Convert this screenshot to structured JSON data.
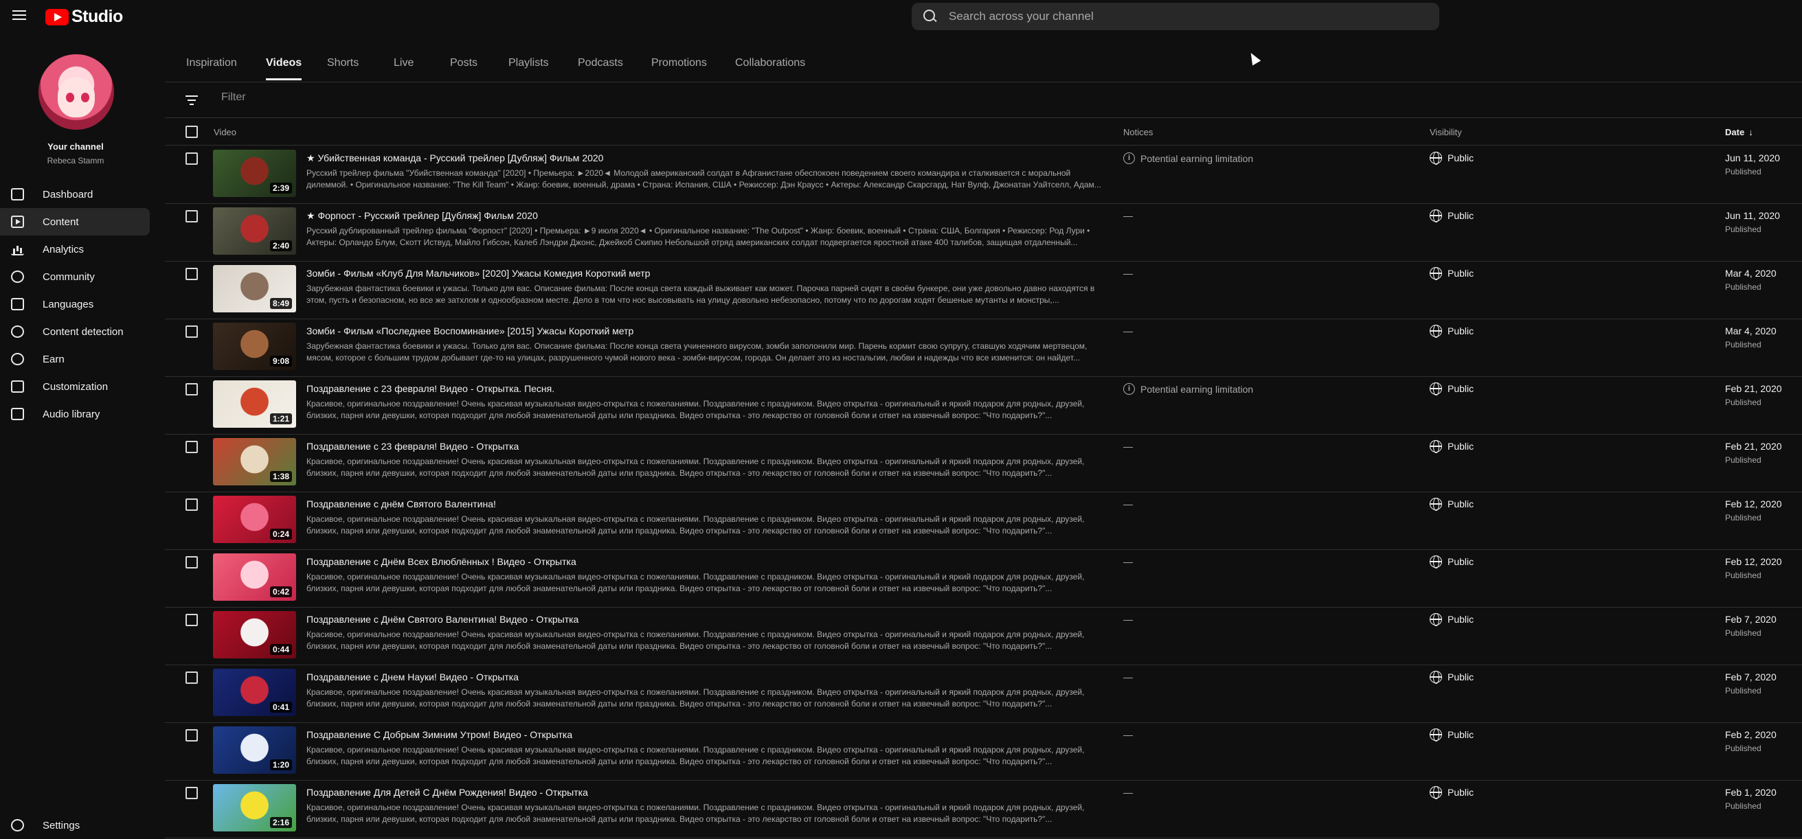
{
  "app": {
    "logo_text": "Studio"
  },
  "search": {
    "placeholder": "Search across your channel"
  },
  "channel": {
    "label": "Your channel",
    "name": "Rebeca Stamm"
  },
  "nav": [
    {
      "label": "Dashboard",
      "icon": "dashboard-icon"
    },
    {
      "label": "Content",
      "icon": "content-icon",
      "active": true
    },
    {
      "label": "Analytics",
      "icon": "analytics-icon"
    },
    {
      "label": "Community",
      "icon": "community-icon"
    },
    {
      "label": "Languages",
      "icon": "languages-icon"
    },
    {
      "label": "Content detection",
      "icon": "copyright-icon"
    },
    {
      "label": "Earn",
      "icon": "dollar-icon"
    },
    {
      "label": "Customization",
      "icon": "magic-wand-icon"
    },
    {
      "label": "Audio library",
      "icon": "audio-library-icon"
    }
  ],
  "settings": {
    "label": "Settings",
    "icon": "gear-icon"
  },
  "tabs": [
    "Inspiration",
    "Videos",
    "Shorts",
    "Live",
    "Posts",
    "Playlists",
    "Podcasts",
    "Promotions",
    "Collaborations"
  ],
  "active_tab": "Videos",
  "filter": {
    "placeholder": "Filter"
  },
  "columns": {
    "video": "Video",
    "notices": "Notices",
    "visibility": "Visibility",
    "date": "Date"
  },
  "colors": {
    "background": "#0f0f0f",
    "accent_red": "#ff0000",
    "row_divider": "#303030"
  },
  "videos": [
    {
      "title": "★ Убийственная команда - Русский трейлер [Дубляж] Фильм 2020",
      "description": "Русский трейлер фильма \"Убийственная команда\" [2020] • Премьера: ►2020◄ Молодой американский солдат в Афганистане обеспокоен поведением своего командира и сталкивается с моральной дилеммой. • Оригинальное название: \"The Kill Team\" • Жанр: боевик, военный, драма • Страна: Испания, США • Режиссер: Дэн Краусс • Актеры: Александр Скарсгард, Нат Вулф, Джонатан Уайтселл, Адам...",
      "duration": "2:39",
      "notice": "Potential earning limitation",
      "visibility": "Public",
      "date": "Jun 11, 2020",
      "status": "Published",
      "thumb": [
        "#3b5c2c",
        "#8a2a1e",
        "#1d2a18"
      ]
    },
    {
      "title": "★ Форпост - Русский трейлер [Дубляж] Фильм 2020",
      "description": "Русский дублированный трейлер фильма \"Форпост\" [2020] • Премьера: ►9 июля 2020◄ • Оригинальное название: \"The Outpost\" • Жанр: боевик, военный • Страна: США, Болгария • Режиссер: Род Лури • Актеры: Орландо Блум, Скотт Иствуд, Майло Гибсон, Калеб Лэндри Джонс, Джейкоб Скипио Небольшой отряд американских солдат подвергается яростной атаке 400 талибов, защищая отдаленный...",
      "duration": "2:40",
      "notice": "—",
      "visibility": "Public",
      "date": "Jun 11, 2020",
      "status": "Published",
      "thumb": [
        "#5c5d4a",
        "#b22c2c",
        "#2a2b22"
      ]
    },
    {
      "title": "Зомби - Фильм «Клуб Для Мальчиков» [2020] Ужасы Комедия Короткий метр",
      "description": "Зарубежная фантастика боевики и ужасы. Только для вас. Описание фильма: После конца света каждый выживает как может. Парочка парней сидят в своём бункере, они уже довольно давно находятся в этом, пусть и безопасном, но все же затхлом и однообразном месте. Дело в том что нос высовывать на улицу довольно небезопасно, потому что по дорогам ходят бешеные мутанты и монстры,...",
      "duration": "8:49",
      "notice": "—",
      "visibility": "Public",
      "date": "Mar 4, 2020",
      "status": "Published",
      "thumb": [
        "#d8d2c8",
        "#8a6f5c",
        "#f0ece6"
      ]
    },
    {
      "title": "Зомби - Фильм «Последнее Воспоминание» [2015] Ужасы Короткий метр",
      "description": "Зарубежная фантастика боевики и ужасы. Только для вас. Описание фильма: После конца света учиненного вирусом, зомби заполонили мир. Парень кормит свою супругу, ставшую ходячим мертвецом, мясом, которое с большим трудом добывает где-то на улицах, разрушенного чумой нового века - зомби-вирусом, города. Он делает это из ностальгии, любви и надежды что все изменится: он найдет...",
      "duration": "9:08",
      "notice": "—",
      "visibility": "Public",
      "date": "Mar 4, 2020",
      "status": "Published",
      "thumb": [
        "#3a2a1e",
        "#a0643c",
        "#1a120c"
      ]
    },
    {
      "title": "Поздравление с 23 февраля! Видео - Открытка. Песня.",
      "description": "Красивое, оригинальное поздравление! Очень красивая музыкальная видео-открытка с пожеланиями. Поздравление с праздником. Видео открытка - оригинальный и яркий подарок для родных, друзей, близких, парня или девушки, которая подходит для любой знаменательной даты или праздника. Видео открытка - это лекарство от головной боли и ответ на извечный вопрос: \"Что подарить?\"...",
      "duration": "1:21",
      "notice": "Potential earning limitation",
      "visibility": "Public",
      "date": "Feb 21, 2020",
      "status": "Published",
      "thumb": [
        "#e8e2d6",
        "#d2462c",
        "#f4f0e8"
      ]
    },
    {
      "title": "Поздравление с 23 февраля! Видео - Открытка",
      "description": "Красивое, оригинальное поздравление! Очень красивая музыкальная видео-открытка с пожеланиями. Поздравление с праздником. Видео открытка - оригинальный и яркий подарок для родных, друзей, близких, парня или девушки, которая подходит для любой знаменательной даты или праздника. Видео открытка - это лекарство от головной боли и ответ на извечный вопрос: \"Что подарить?\"...",
      "duration": "1:38",
      "notice": "—",
      "visibility": "Public",
      "date": "Feb 21, 2020",
      "status": "Published",
      "thumb": [
        "#c84432",
        "#e8d8c0",
        "#5a7a3a"
      ]
    },
    {
      "title": "Поздравление с днём Святого Валентина!",
      "description": "Красивое, оригинальное поздравление! Очень красивая музыкальная видео-открытка с пожеланиями. Поздравление с праздником. Видео открытка - оригинальный и яркий подарок для родных, друзей, близких, парня или девушки, которая подходит для любой знаменательной даты или праздника. Видео открытка - это лекарство от головной боли и ответ на извечный вопрос: \"Что подарить?\"...",
      "duration": "0:24",
      "notice": "—",
      "visibility": "Public",
      "date": "Feb 12, 2020",
      "status": "Published",
      "thumb": [
        "#d81e3c",
        "#f06a8a",
        "#8c0e24"
      ]
    },
    {
      "title": "Поздравление с Днём Всех Влюблённых ! Видео - Открытка",
      "description": "Красивое, оригинальное поздравление! Очень красивая музыкальная видео-открытка с пожеланиями. Поздравление с праздником. Видео открытка - оригинальный и яркий подарок для родных, друзей, близких, парня или девушки, которая подходит для любой знаменательной даты или праздника. Видео открытка - это лекарство от головной боли и ответ на извечный вопрос: \"Что подарить?\"...",
      "duration": "0:42",
      "notice": "—",
      "visibility": "Public",
      "date": "Feb 12, 2020",
      "status": "Published",
      "thumb": [
        "#f0607a",
        "#ffd0dc",
        "#c8244a"
      ]
    },
    {
      "title": "Поздравление с Днём Святого Валентина! Видео - Открытка",
      "description": "Красивое, оригинальное поздравление! Очень красивая музыкальная видео-открытка с пожеланиями. Поздравление с праздником. Видео открытка - оригинальный и яркий подарок для родных, друзей, близких, парня или девушки, которая подходит для любой знаменательной даты или праздника. Видео открытка - это лекарство от головной боли и ответ на извечный вопрос: \"Что подарить?\"...",
      "duration": "0:44",
      "notice": "—",
      "visibility": "Public",
      "date": "Feb 7, 2020",
      "status": "Published",
      "thumb": [
        "#b01028",
        "#f4f0f0",
        "#6a0814"
      ]
    },
    {
      "title": "Поздравление с Днем Науки! Видео - Открытка",
      "description": "Красивое, оригинальное поздравление! Очень красивая музыкальная видео-открытка с пожеланиями. Поздравление с праздником. Видео открытка - оригинальный и яркий подарок для родных, друзей, близких, парня или девушки, которая подходит для любой знаменательной даты или праздника. Видео открытка - это лекарство от головной боли и ответ на извечный вопрос: \"Что подарить?\"...",
      "duration": "0:41",
      "notice": "—",
      "visibility": "Public",
      "date": "Feb 7, 2020",
      "status": "Published",
      "thumb": [
        "#1a2a78",
        "#c8283c",
        "#0a1040"
      ]
    },
    {
      "title": "Поздравление С Добрым Зимним Утром! Видео - Открытка",
      "description": "Красивое, оригинальное поздравление! Очень красивая музыкальная видео-открытка с пожеланиями. Поздравление с праздником. Видео открытка - оригинальный и яркий подарок для родных, друзей, близких, парня или девушки, которая подходит для любой знаменательной даты или праздника. Видео открытка - это лекарство от головной боли и ответ на извечный вопрос: \"Что подарить?\"...",
      "duration": "1:20",
      "notice": "—",
      "visibility": "Public",
      "date": "Feb 2, 2020",
      "status": "Published",
      "thumb": [
        "#1e3c8c",
        "#e8eef8",
        "#0c1c48"
      ]
    },
    {
      "title": "Поздравление Для Детей С Днём Рождения! Видео - Открытка",
      "description": "Красивое, оригинальное поздравление! Очень красивая музыкальная видео-открытка с пожеланиями. Поздравление с праздником. Видео открытка - оригинальный и яркий подарок для родных, друзей, близких, парня или девушки, которая подходит для любой знаменательной даты или праздника. Видео открытка - это лекарство от головной боли и ответ на извечный вопрос: \"Что подарить?\"...",
      "duration": "2:16",
      "notice": "—",
      "visibility": "Public",
      "date": "Feb 1, 2020",
      "status": "Published",
      "thumb": [
        "#6ab8e8",
        "#f4e030",
        "#48a040"
      ]
    }
  ]
}
